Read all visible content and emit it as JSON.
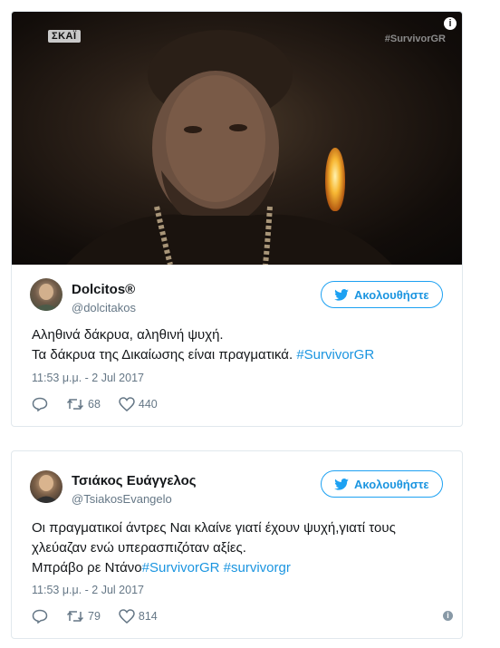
{
  "video": {
    "channel_logo": "ΣΚΑΪ",
    "hashtag_overlay": "#SurvivorGR",
    "info_icon": "info-icon"
  },
  "tweets": [
    {
      "name": "Dolcitos®",
      "handle": "@dolcitakos",
      "follow_label": "Ακολουθήστε",
      "text_line1": "Αληθινά δάκρυα, αληθινή ψυχή.",
      "text_line2_plain": "Τα δάκρυα της Δικαίωσης είναι πραγματικά. ",
      "text_line2_hashtag": "#SurvivorGR",
      "timestamp": "11:53 μ.μ. - 2 Jul 2017",
      "retweets": "68",
      "likes": "440"
    },
    {
      "name": "Τσιάκος Ευάγγελος",
      "handle": "@TsiakosEvangelo",
      "follow_label": "Ακολουθήστε",
      "text_line1": "Οι πραγματικοί άντρες Ναι κλαίνε γιατί έχουν ψυχή,γιατί τους",
      "text_line2": "χλεύαζαν ενώ υπερασπιζόταν αξίες.",
      "text_line3_plain": "Μπράβο ρε Ντάνο",
      "text_line3_hashtag1": "#SurvivorGR",
      "text_line3_hashtag2": "#survivorgr",
      "timestamp": "11:53 μ.μ. - 2 Jul 2017",
      "retweets": "79",
      "likes": "814"
    }
  ],
  "colors": {
    "accent": "#1da1f2",
    "link": "#1b95e0",
    "muted": "#657786",
    "border": "#e1e8ed"
  }
}
